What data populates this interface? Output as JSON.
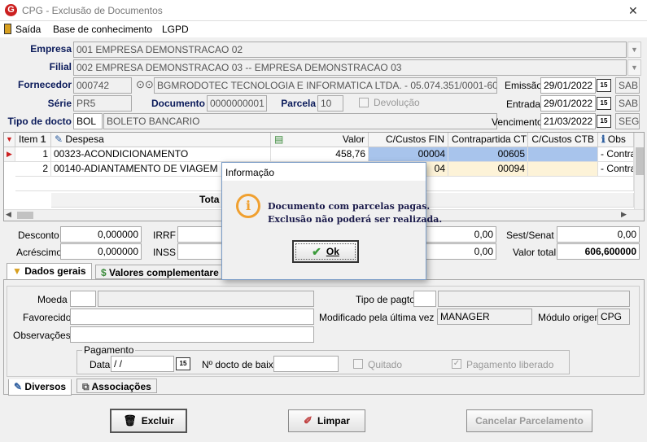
{
  "window": {
    "title": "CPG - Exclusão de Documentos",
    "close_glyph": "✕"
  },
  "menu": {
    "items": [
      "Saída",
      "Base de conhecimento",
      "LGPD"
    ]
  },
  "header": {
    "empresa_label": "Empresa",
    "empresa_value": "001 EMPRESA DEMONSTRACAO 02",
    "filial_label": "Filial",
    "filial_value": "002 EMPRESA DEMONSTRACAO 03 -- EMPRESA DEMONSTRACAO 03",
    "fornecedor_label": "Fornecedor",
    "fornecedor_code": "000742",
    "fornecedor_name": "BGMRODOTEC TECNOLOGIA E INFORMATICA LTDA. - 05.074.351/0001-60",
    "serie_label": "Série",
    "serie_value": "PR5",
    "documento_label": "Documento",
    "documento_value": "0000000001",
    "parcela_label": "Parcela",
    "parcela_value": "10",
    "devolucao_label": "Devolução",
    "tipo_label": "Tipo de docto",
    "tipo_code": "BOL",
    "tipo_name": "BOLETO BANCARIO",
    "emissao_label": "Emissão",
    "emissao_value": "29/01/2022",
    "emissao_day": "SAB",
    "entrada_label": "Entrada",
    "entrada_value": "29/01/2022",
    "entrada_day": "SAB",
    "vencimento_label": "Vencimento",
    "vencimento_value": "21/03/2022",
    "vencimento_day": "SEG",
    "calendar_glyph": "15"
  },
  "grid": {
    "columns": [
      "Item",
      "Despesa",
      "Valor",
      "C/Custos FIN",
      "Contrapartida CTB",
      "C/Custos CTB",
      "Obs"
    ],
    "sort_index": "1",
    "rows": [
      {
        "item": "1",
        "despesa": "00323-ACONDICIONAMENTO",
        "valor": "458,76",
        "ccfin": "00004",
        "contra": "00605",
        "ccctb": "",
        "obs": "- Contra"
      },
      {
        "item": "2",
        "despesa": "00140-ADIANTAMENTO DE VIAGEM",
        "valor": "",
        "ccfin": "04",
        "contra": "00094",
        "ccctb": "",
        "obs": "- Contra"
      }
    ],
    "total_label": "Tota"
  },
  "totals": {
    "desconto_label": "Desconto",
    "desconto_value": "0,000000",
    "irrf_label": "IRRF",
    "acrescimo_label": "Acréscimo",
    "acrescimo_value": "0,000000",
    "inss_label": "INSS",
    "mid_value_1": "0,00",
    "mid_value_2": "0,00",
    "sestsenat_label": "Sest/Senat",
    "sestsenat_value": "0,00",
    "valortotal_label": "Valor total",
    "valortotal_value": "606,600000"
  },
  "tabs_top": [
    "Dados gerais",
    "Valores complementare"
  ],
  "dados": {
    "moeda_label": "Moeda",
    "favorecido_label": "Favorecido",
    "observacoes_label": "Observações",
    "tipopagto_label": "Tipo de pagto",
    "modificado_label": "Modificado pela última vez por",
    "modificado_value": "MANAGER",
    "modulo_label": "Módulo origem",
    "modulo_value": "CPG",
    "pagamento_group": "Pagamento",
    "data_label": "Data",
    "data_value": " / /",
    "ndocto_label": "Nº docto de baixa",
    "quitado_label": "Quitado",
    "liberado_label": "Pagamento liberado"
  },
  "tabs_bottom": [
    "Diversos",
    "Associações"
  ],
  "buttons": {
    "excluir": "Excluir",
    "limpar": "Limpar",
    "cancelar": "Cancelar Parcelamento"
  },
  "dialog": {
    "title": "Informação",
    "line1": "Documento com parcelas pagas.",
    "line2": "Exclusão não poderá ser realizada.",
    "ok": "Ok",
    "icon_glyph": "i"
  },
  "colors": {
    "accent_red": "#cc2020",
    "selected_blue": "#a8c4ec",
    "row_yellow": "#fdf3d8",
    "info_orange": "#f0a030"
  }
}
